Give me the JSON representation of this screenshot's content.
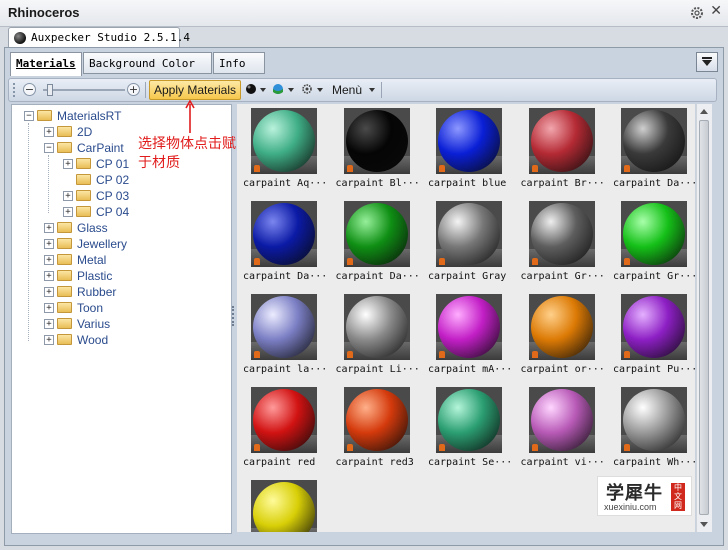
{
  "window": {
    "title": "Rhinoceros"
  },
  "document_tab": {
    "label": "Auxpecker Studio 2.5.1.4"
  },
  "panel_tabs": [
    {
      "label": "Materials"
    },
    {
      "label": "Background Color"
    },
    {
      "label": "Info"
    }
  ],
  "toolbar": {
    "zoom_out": "−",
    "zoom_in": "+",
    "apply_label": "Apply Materials",
    "menu_label": "Menù"
  },
  "annotation": {
    "text": "选择物体点击赋于材质",
    "color": "#e11c1c"
  },
  "tree": {
    "root": "MaterialsRT",
    "items": [
      {
        "label": "2D",
        "level": 1,
        "expander": "+"
      },
      {
        "label": "CarPaint",
        "level": 1,
        "expander": "−"
      },
      {
        "label": "CP 01",
        "level": 2,
        "expander": "+"
      },
      {
        "label": "CP 02",
        "level": 2,
        "expander": ""
      },
      {
        "label": "CP 03",
        "level": 2,
        "expander": "+"
      },
      {
        "label": "CP 04",
        "level": 2,
        "expander": "+"
      },
      {
        "label": "Glass",
        "level": 1,
        "expander": "+"
      },
      {
        "label": "Jewellery",
        "level": 1,
        "expander": "+"
      },
      {
        "label": "Metal",
        "level": 1,
        "expander": "+"
      },
      {
        "label": "Plastic",
        "level": 1,
        "expander": "+"
      },
      {
        "label": "Rubber",
        "level": 1,
        "expander": "+"
      },
      {
        "label": "Toon",
        "level": 1,
        "expander": "+"
      },
      {
        "label": "Varius",
        "level": 1,
        "expander": "+"
      },
      {
        "label": "Wood",
        "level": 1,
        "expander": "+"
      }
    ]
  },
  "materials": [
    {
      "name": "carpaint Aq···",
      "color": "#3fae86",
      "hl": "#b9f2dc"
    },
    {
      "name": "carpaint Bl···",
      "color": "#050505",
      "hl": "#4a4a4a"
    },
    {
      "name": "carpaint blue",
      "color": "#0a1fd6",
      "hl": "#8d98ff"
    },
    {
      "name": "carpaint Br···",
      "color": "#b42a34",
      "hl": "#f2a6ad"
    },
    {
      "name": "carpaint Da···",
      "color": "#3a3a3a",
      "hl": "#cfcfcf"
    },
    {
      "name": "carpaint Da···",
      "color": "#0b1aa5",
      "hl": "#7b86ef"
    },
    {
      "name": "carpaint Da···",
      "color": "#0f8f14",
      "hl": "#96ef9a"
    },
    {
      "name": "carpaint Gray",
      "color": "#777777",
      "hl": "#f4f4f4"
    },
    {
      "name": "carpaint Gr···",
      "color": "#5e5e5e",
      "hl": "#eeeeee"
    },
    {
      "name": "carpaint Gr···",
      "color": "#15c018",
      "hl": "#a8ffaa"
    },
    {
      "name": "carpaint la···",
      "color": "#7b7fc4",
      "hl": "#ececff"
    },
    {
      "name": "carpaint Li···",
      "color": "#8a8a8a",
      "hl": "#ffffff"
    },
    {
      "name": "carpaint mA···",
      "color": "#c21fc6",
      "hl": "#ffadff"
    },
    {
      "name": "carpaint or···",
      "color": "#dc7a05",
      "hl": "#ffd08a"
    },
    {
      "name": "carpaint Pu···",
      "color": "#8d1fc4",
      "hl": "#e4b0ff"
    },
    {
      "name": "carpaint red",
      "color": "#d11212",
      "hl": "#ff9a9a"
    },
    {
      "name": "carpaint red3",
      "color": "#d43a0c",
      "hl": "#ffb08a"
    },
    {
      "name": "carpaint Se···",
      "color": "#2b9e72",
      "hl": "#b4f5da"
    },
    {
      "name": "carpaint vi···",
      "color": "#b85ab7",
      "hl": "#ffd6ff"
    },
    {
      "name": "carpaint Wh···",
      "color": "#999999",
      "hl": "#ffffff"
    },
    {
      "name": "",
      "color": "#d8cf07",
      "hl": "#fffb9a"
    }
  ],
  "watermark": {
    "big": "学犀牛",
    "small": "xuexiniu.com",
    "seal": "中文网"
  }
}
